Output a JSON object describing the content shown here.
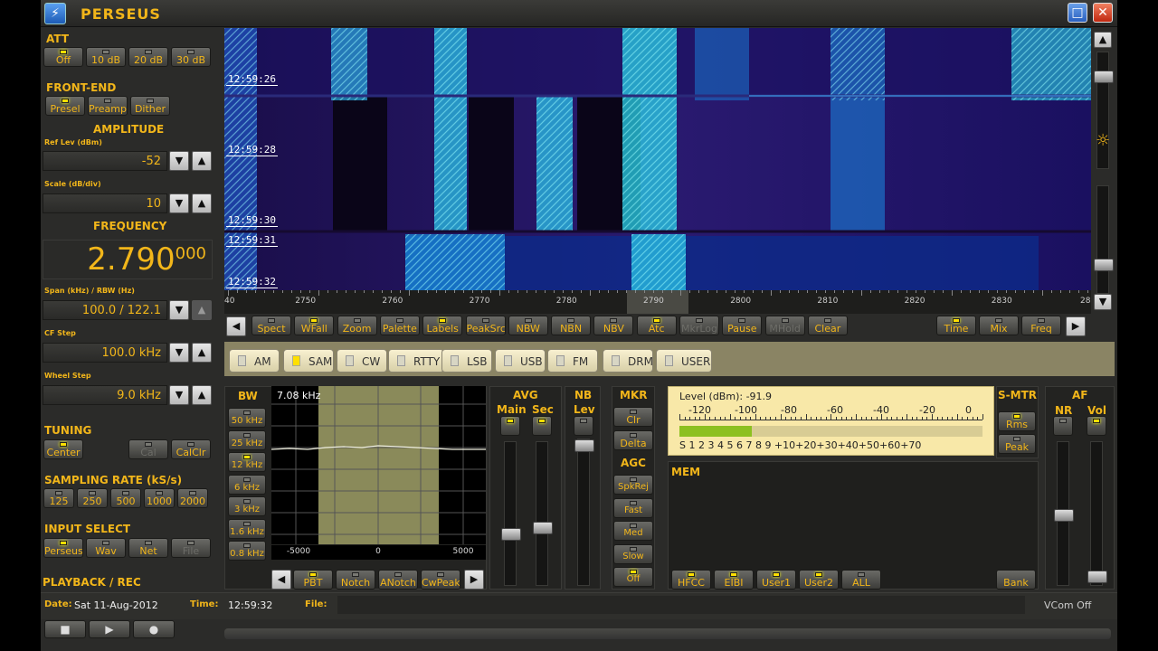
{
  "app": {
    "title": "PERSEUS",
    "logo_glyph": "⚡",
    "minimize": "□",
    "close": "✕"
  },
  "att": {
    "label": "ATT",
    "buttons": [
      "Off",
      "10 dB",
      "20 dB",
      "30 dB"
    ]
  },
  "front_end": {
    "label": "FRONT-END",
    "buttons": [
      "Presel",
      "Preamp",
      "Dither"
    ]
  },
  "amplitude": {
    "label": "AMPLITUDE",
    "ref_label": "Ref Lev (dBm)",
    "ref_value": "-52",
    "scale_label": "Scale (dB/div)",
    "scale_value": "10"
  },
  "frequency": {
    "label": "FREQUENCY",
    "main": "2.790",
    "sub": "000",
    "span_label": "Span (kHz) / RBW (Hz)",
    "span_value": "100.0 / 122.1",
    "cf_label": "CF Step",
    "cf_value": "100.0 kHz",
    "wheel_label": "Wheel Step",
    "wheel_value": "9.0 kHz"
  },
  "tuning": {
    "label": "TUNING",
    "buttons": [
      "Center",
      "Cal",
      "CalClr"
    ]
  },
  "sampling": {
    "label": "SAMPLING RATE (kS/s)",
    "buttons": [
      "125",
      "250",
      "500",
      "1000",
      "2000"
    ]
  },
  "input": {
    "label": "INPUT SELECT",
    "buttons": [
      "Perseus",
      "Wav",
      "Net",
      "File"
    ]
  },
  "playback": {
    "label": "PLAYBACK / REC"
  },
  "waterfall": {
    "timestamps": [
      "12:59:26",
      "12:59:28",
      "12:59:30",
      "12:59:31",
      "12:59:32"
    ],
    "axis_ticks": [
      "40",
      "2750",
      "2760",
      "2770",
      "2780",
      "2790",
      "2800",
      "2810",
      "2820",
      "2830",
      "28"
    ]
  },
  "toolbar": {
    "left_arrow": "◀",
    "right_arrow": "▶",
    "buttons": [
      "Spect",
      "WFall",
      "Zoom",
      "Palette",
      "Labels",
      "PeakSrc",
      "NBW",
      "NBN",
      "NBV",
      "Atc",
      "MkrLog",
      "Pause",
      "MHold",
      "Clear",
      "Time",
      "Mix",
      "Freq"
    ]
  },
  "modes": [
    "AM",
    "SAM",
    "CW",
    "RTTY",
    "LSB",
    "USB",
    "FM",
    "DRM",
    "USER"
  ],
  "bw": {
    "label": "BW",
    "buttons": [
      "50 kHz",
      "25 kHz",
      "12 kHz",
      "6 kHz",
      "3 kHz",
      "1.6 kHz",
      "0.8 kHz"
    ],
    "readout": "7.08 kHz",
    "axis": [
      "-5000",
      "0",
      "5000"
    ]
  },
  "filter_bar": {
    "buttons": [
      "PBT",
      "Notch",
      "ANotch",
      "CwPeak"
    ]
  },
  "avg": {
    "label": "AVG",
    "main": "Main",
    "sec": "Sec"
  },
  "nb": {
    "label": "NB",
    "lev": "Lev"
  },
  "mkr": {
    "label": "MKR",
    "buttons": [
      "Clr",
      "Delta"
    ]
  },
  "agc": {
    "label": "AGC",
    "buttons": [
      "SpkRej",
      "Fast",
      "Med",
      "Slow",
      "Off"
    ]
  },
  "smeter": {
    "level_label": "Level (dBm):",
    "level_value": "-91.9",
    "scale_top": [
      "-120",
      "-100",
      "-80",
      "-60",
      "-40",
      "-20",
      "0"
    ],
    "scale_bottom": "S 1 2 3 4 5 6 7 8 9 +10+20+30+40+50+60+70",
    "fill_fraction": 0.24,
    "label": "S-MTR",
    "buttons": [
      "Rms",
      "Peak"
    ]
  },
  "mem": {
    "label": "MEM",
    "buttons": [
      "HFCC",
      "EIBI",
      "User1",
      "User2",
      "ALL"
    ],
    "bank": "Bank"
  },
  "af": {
    "label": "AF",
    "nr": "NR",
    "vol": "Vol"
  },
  "status": {
    "date_label": "Date:",
    "date_value": "Sat 11-Aug-2012",
    "time_label": "Time:",
    "time_value": "12:59:32",
    "file_label": "File:",
    "vcom": "VCom Off"
  },
  "transport": [
    "■",
    "▶",
    "●"
  ],
  "colors": {
    "accent": "#f2b61a",
    "led_on": "#ffe000",
    "meter_bg": "#f8e8a8",
    "filter_passband": "#8a8a5a"
  }
}
